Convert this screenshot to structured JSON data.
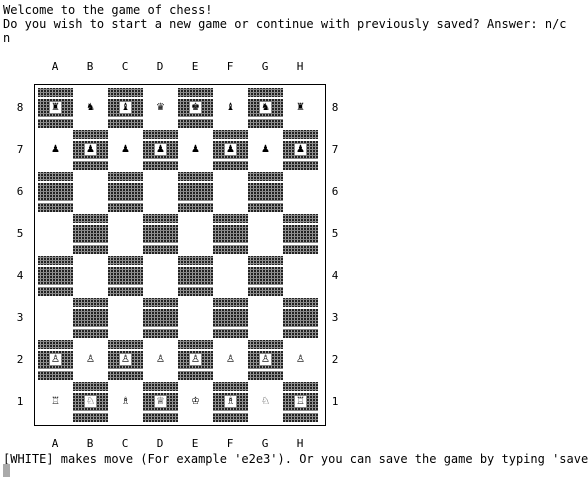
{
  "terminal": {
    "line1": "Welcome to the game of chess!",
    "line2": "Do you wish to start a new game or continue with previously saved? Answer: n/c",
    "line3": "n",
    "prompt": "[WHITE] makes move (For example 'e2e3'). Or you can save the game by typing 'save'"
  },
  "board": {
    "files": [
      "A",
      "B",
      "C",
      "D",
      "E",
      "F",
      "G",
      "H"
    ],
    "ranks": [
      "8",
      "7",
      "6",
      "5",
      "4",
      "3",
      "2",
      "1"
    ],
    "pieces": {
      "8": [
        "♜",
        "♞",
        "♝",
        "♛",
        "♚",
        "♝",
        "♞",
        "♜"
      ],
      "7": [
        "♟",
        "♟",
        "♟",
        "♟",
        "♟",
        "♟",
        "♟",
        "♟"
      ],
      "6": [
        "",
        "",
        "",
        "",
        "",
        "",
        "",
        ""
      ],
      "5": [
        "",
        "",
        "",
        "",
        "",
        "",
        "",
        ""
      ],
      "4": [
        "",
        "",
        "",
        "",
        "",
        "",
        "",
        ""
      ],
      "3": [
        "",
        "",
        "",
        "",
        "",
        "",
        "",
        ""
      ],
      "2": [
        "♙",
        "♙",
        "♙",
        "♙",
        "♙",
        "♙",
        "♙",
        "♙"
      ],
      "1": [
        "♖",
        "♘",
        "♗",
        "♕",
        "♔",
        "♗",
        "♘",
        "♖"
      ]
    }
  },
  "colors": {
    "background": "#ffffff",
    "text": "#000000"
  }
}
